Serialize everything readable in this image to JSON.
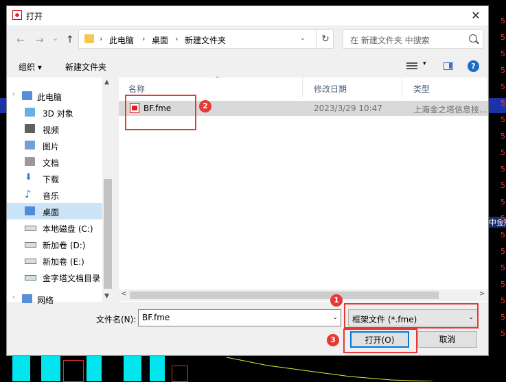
{
  "dialog": {
    "title": "打开",
    "close_glyph": "✕"
  },
  "nav": {
    "back_glyph": "←",
    "forward_glyph": "→",
    "history_glyph": "⌄",
    "up_glyph": "↑"
  },
  "address": {
    "crumbs": [
      "此电脑",
      "桌面",
      "新建文件夹"
    ],
    "separator": "›",
    "dropdown_glyph": "⌄",
    "refresh_glyph": "↻"
  },
  "search": {
    "placeholder": "在 新建文件夹 中搜索"
  },
  "toolbar": {
    "organize_label": "组织 ▾",
    "new_folder_label": "新建文件夹",
    "view_dropdown_glyph": "▾",
    "help_glyph": "?"
  },
  "sidebar": {
    "items": [
      {
        "label": "此电脑",
        "icon": "computer-icon"
      },
      {
        "label": "3D 对象",
        "icon": "cube-icon"
      },
      {
        "label": "视频",
        "icon": "video-icon"
      },
      {
        "label": "图片",
        "icon": "picture-icon"
      },
      {
        "label": "文档",
        "icon": "document-icon"
      },
      {
        "label": "下载",
        "icon": "download-icon"
      },
      {
        "label": "音乐",
        "icon": "music-icon"
      },
      {
        "label": "桌面",
        "icon": "desktop-icon",
        "selected": true
      },
      {
        "label": "本地磁盘 (C:)",
        "icon": "drive-icon"
      },
      {
        "label": "新加卷 (D:)",
        "icon": "drive-icon"
      },
      {
        "label": "新加卷 (E:)",
        "icon": "drive-icon"
      },
      {
        "label": "金字塔文档目录",
        "icon": "network-drive-icon"
      },
      {
        "label": "网络",
        "icon": "network-icon"
      }
    ],
    "expand_glyph": "›"
  },
  "filelist": {
    "columns": [
      "名称",
      "修改日期",
      "类型"
    ],
    "sort_glyph": "^",
    "rows": [
      {
        "name": "BF.fme",
        "modified": "2023/3/29 10:47",
        "type": "上海金之塔信息技..."
      }
    ]
  },
  "scroll": {
    "up": "▲",
    "down": "▼",
    "left": "<",
    "right": ">"
  },
  "bottom": {
    "filename_label": "文件名(N):",
    "filename_value": "BF.fme",
    "filename_dd": "⌄",
    "filetype_value": "框架文件 (*.fme)",
    "filetype_dd": "⌄",
    "open_label": "打开(O)",
    "cancel_label": "取消"
  },
  "annotations": {
    "badge1": "1",
    "badge2": "2",
    "badge3": "3",
    "color": "#e53935"
  },
  "background": {
    "right_label": "中金所",
    "right_numbers": [
      "5",
      "5",
      "5",
      "5",
      "5",
      "5",
      "5",
      "5",
      "5",
      "5",
      "5",
      "5",
      "5",
      "5",
      "5",
      "5",
      "5",
      "5",
      "5",
      "5"
    ]
  }
}
